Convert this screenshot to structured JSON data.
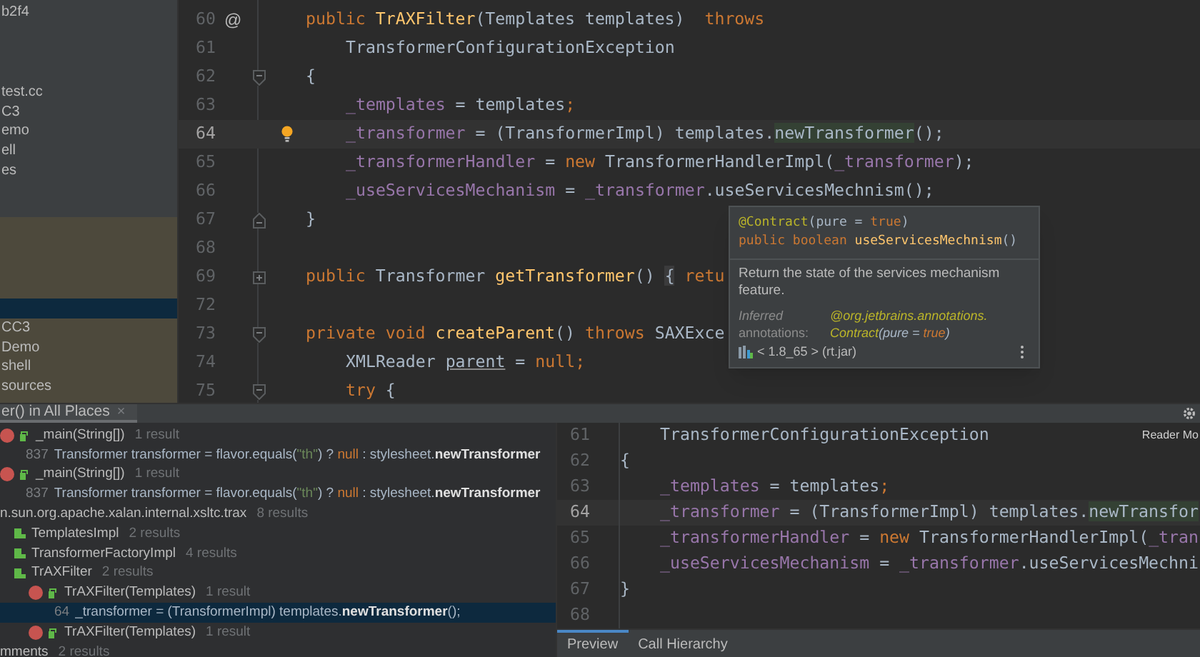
{
  "project_tree": {
    "sections": [
      {
        "highlighted": false,
        "items": [
          {
            "label": "b2f4",
            "selected": false
          },
          {
            "label": "test.cc",
            "selected": false
          },
          {
            "label": "C3",
            "selected": false
          },
          {
            "label": "emo",
            "selected": false
          },
          {
            "label": "ell",
            "selected": false
          },
          {
            "label": "es",
            "selected": false
          }
        ]
      },
      {
        "highlighted": true,
        "items": [
          {
            "selected": true
          },
          {
            "label": "CC3",
            "selected": false
          },
          {
            "label": "Demo",
            "selected": false
          },
          {
            "label": "shell",
            "selected": false
          },
          {
            "label": "sources",
            "selected": false
          }
        ]
      }
    ]
  },
  "editor": {
    "lines": [
      {
        "number": "60",
        "marker": "@",
        "bulb": false,
        "current": false,
        "indented": false,
        "segments": [
          {
            "kind": "kw",
            "text": "public "
          },
          {
            "kind": "fn",
            "text": "TrAXFilter"
          },
          {
            "kind": "plain",
            "text": "(Templates templates)  "
          },
          {
            "kind": "kw",
            "text": "throws"
          }
        ]
      },
      {
        "number": "61",
        "bulb": false,
        "current": false,
        "indented": true,
        "segments": [
          {
            "kind": "plain",
            "text": "TransformerConfigurationException"
          }
        ]
      },
      {
        "number": "62",
        "fold": {
          "kind": "open"
        },
        "bulb": false,
        "current": false,
        "indented": false,
        "segments": [
          {
            "kind": "plain",
            "text": "{"
          }
        ]
      },
      {
        "number": "63",
        "bulb": false,
        "current": false,
        "indented": true,
        "segments": [
          {
            "kind": "field",
            "text": "_templates"
          },
          {
            "kind": "plain",
            "text": " = templates"
          },
          {
            "kind": "kw",
            "text": ";"
          }
        ]
      },
      {
        "number": "64",
        "bulb": true,
        "current": true,
        "indented": true,
        "segments": [
          {
            "kind": "field",
            "text": "_transformer"
          },
          {
            "kind": "plain",
            "text": " = (TransformerImpl) templates."
          },
          {
            "kind": "match",
            "text": "newTransformer"
          },
          {
            "kind": "plain",
            "text": "();"
          }
        ]
      },
      {
        "number": "65",
        "bulb": false,
        "current": false,
        "indented": true,
        "segments": [
          {
            "kind": "field",
            "text": "_transformerHandler"
          },
          {
            "kind": "plain",
            "text": " = "
          },
          {
            "kind": "kw",
            "text": "new"
          },
          {
            "kind": "plain",
            "text": " TransformerHandlerImpl("
          },
          {
            "kind": "field",
            "text": "_transformer"
          },
          {
            "kind": "plain",
            "text": ");"
          }
        ]
      },
      {
        "number": "66",
        "bulb": false,
        "current": false,
        "indented": true,
        "segments": [
          {
            "kind": "field",
            "text": "_useServicesMechanism"
          },
          {
            "kind": "plain",
            "text": " = "
          },
          {
            "kind": "field",
            "text": "_transformer"
          },
          {
            "kind": "plain",
            "text": ".useServicesMechnism();"
          }
        ]
      },
      {
        "number": "67",
        "fold": {
          "kind": "close"
        },
        "bulb": false,
        "current": false,
        "indented": false,
        "segments": [
          {
            "kind": "plain",
            "text": "}"
          }
        ]
      },
      {
        "number": "68",
        "bulb": false,
        "current": false
      },
      {
        "number": "69",
        "fold": {
          "kind": "collapsed"
        },
        "bulb": false,
        "current": false,
        "indented": false,
        "segments": [
          {
            "kind": "kw",
            "text": "public "
          },
          {
            "kind": "plain",
            "text": "Transformer "
          },
          {
            "kind": "fn",
            "text": "getTransformer"
          },
          {
            "kind": "plain",
            "text": "() "
          },
          {
            "kind": "folded",
            "text": "{"
          },
          {
            "kind": "kw",
            "text": " retu"
          }
        ]
      },
      {
        "number": "72",
        "bulb": false,
        "current": false
      },
      {
        "number": "73",
        "fold": {
          "kind": "open"
        },
        "bulb": false,
        "current": false,
        "indented": false,
        "segments": [
          {
            "kind": "kw",
            "text": "private void "
          },
          {
            "kind": "fn",
            "text": "createParent"
          },
          {
            "kind": "plain",
            "text": "() "
          },
          {
            "kind": "kw",
            "text": "throws "
          },
          {
            "kind": "plain",
            "text": "SAXExce"
          }
        ]
      },
      {
        "number": "74",
        "bulb": false,
        "current": false,
        "indented": true,
        "segments": [
          {
            "kind": "plain",
            "text": "XMLReader "
          },
          {
            "kind": "under",
            "text": "parent"
          },
          {
            "kind": "plain",
            "text": " = "
          },
          {
            "kind": "kw",
            "text": "null;"
          }
        ]
      },
      {
        "number": "75",
        "fold": {
          "kind": "open"
        },
        "bulb": false,
        "current": false,
        "indented": true,
        "segments": [
          {
            "kind": "kw",
            "text": "try"
          },
          {
            "kind": "plain",
            "text": " {"
          }
        ]
      }
    ]
  },
  "tooltip": {
    "signature": [
      [
        {
          "kind": "anno",
          "text": "@Contract"
        },
        {
          "kind": "plain",
          "text": "(pure = "
        },
        {
          "kind": "kw",
          "text": "true"
        },
        {
          "kind": "plain",
          "text": ")"
        }
      ],
      [
        {
          "kind": "kw",
          "text": "public boolean "
        },
        {
          "kind": "fn",
          "text": "useServicesMechnism"
        },
        {
          "kind": "plain",
          "text": "()"
        }
      ]
    ],
    "description": "Return the state of the services mechanism feature.",
    "annotations_label": "*Inferred* annotations:",
    "annotations_value": [
      [
        {
          "kind": "anno",
          "text": "@org.jetbrains.annotations."
        }
      ],
      [
        {
          "kind": "anno",
          "text": "Contract"
        },
        {
          "kind": "plain",
          "text": "(pure = "
        },
        {
          "kind": "kw",
          "text": "true"
        },
        {
          "kind": "plain",
          "text": ")"
        }
      ]
    ],
    "library": "< 1.8_65 > (rt.jar)"
  },
  "find_panel": {
    "tab": {
      "label": "er() in All Places",
      "close": "×",
      "selected": true
    },
    "results": [
      {
        "kind": "method",
        "label": "_main(String[])",
        "count": "1 result",
        "selected": false,
        "children": [
          {
            "kind": "usage",
            "line": "837",
            "selected": false,
            "segments": [
              {
                "kind": "plain",
                "text": "Transformer transformer = flavor.equals("
              },
              {
                "kind": "str",
                "text": "\"th\""
              },
              {
                "kind": "plain",
                "text": ") ? "
              },
              {
                "kind": "kw",
                "text": "null"
              },
              {
                "kind": "plain",
                "text": " : stylesheet."
              },
              {
                "kind": "bold",
                "text": "newTransformer"
              }
            ]
          }
        ]
      },
      {
        "kind": "method",
        "label": "_main(String[])",
        "count": "1 result",
        "selected": false,
        "children": [
          {
            "kind": "usage",
            "line": "837",
            "selected": false,
            "segments": [
              {
                "kind": "plain",
                "text": "Transformer transformer = flavor.equals("
              },
              {
                "kind": "str",
                "text": "\"th\""
              },
              {
                "kind": "plain",
                "text": ") ? "
              },
              {
                "kind": "kw",
                "text": "null"
              },
              {
                "kind": "plain",
                "text": " : stylesheet."
              },
              {
                "kind": "bold",
                "text": "newTransformer"
              }
            ]
          }
        ]
      },
      {
        "kind": "package",
        "label": "n.sun.org.apache.xalan.internal.xsltc.trax",
        "count": "8 results",
        "selected": false,
        "children": [
          {
            "kind": "class",
            "label": "TemplatesImpl",
            "count": "2 results",
            "selected": false
          },
          {
            "kind": "class",
            "label": "TransformerFactoryImpl",
            "count": "4 results",
            "selected": false
          },
          {
            "kind": "class",
            "label": "TrAXFilter",
            "count": "2 results",
            "selected": false,
            "children": [
              {
                "kind": "method",
                "label": "TrAXFilter(Templates)",
                "count": "1 result",
                "selected": false,
                "children": [
                  {
                    "kind": "usage",
                    "line": "64",
                    "selected": true,
                    "segments": [
                      {
                        "kind": "plain",
                        "text": "_transformer = (TransformerImpl) templates."
                      },
                      {
                        "kind": "bold",
                        "text": "newTransformer"
                      },
                      {
                        "kind": "plain",
                        "text": "();"
                      }
                    ]
                  }
                ]
              },
              {
                "kind": "method",
                "label": "TrAXFilter(Templates)",
                "count": "1 result",
                "selected": false
              }
            ]
          }
        ]
      },
      {
        "kind": "package",
        "label": "mments",
        "count": "2 results",
        "selected": false
      }
    ],
    "preview": {
      "reader_mode": "Reader Mo",
      "lines": [
        {
          "number": "61",
          "current": false,
          "indented": true,
          "segments": [
            {
              "kind": "plain",
              "text": "TransformerConfigurationException"
            }
          ]
        },
        {
          "number": "62",
          "current": false,
          "indented": false,
          "segments": [
            {
              "kind": "plain",
              "text": "{"
            }
          ]
        },
        {
          "number": "63",
          "current": false,
          "indented": true,
          "segments": [
            {
              "kind": "field",
              "text": "_templates"
            },
            {
              "kind": "plain",
              "text": " = templates"
            },
            {
              "kind": "kw",
              "text": ";"
            }
          ]
        },
        {
          "number": "64",
          "current": true,
          "indented": true,
          "segments": [
            {
              "kind": "field",
              "text": "_transformer"
            },
            {
              "kind": "plain",
              "text": " = (TransformerImpl) templates."
            },
            {
              "kind": "match",
              "text": "newTransfor"
            }
          ]
        },
        {
          "number": "65",
          "current": false,
          "indented": true,
          "segments": [
            {
              "kind": "field",
              "text": "_transformerHandler"
            },
            {
              "kind": "plain",
              "text": " = "
            },
            {
              "kind": "kw",
              "text": "new"
            },
            {
              "kind": "plain",
              "text": " TransformerHandlerImpl("
            },
            {
              "kind": "field",
              "text": "_tran"
            }
          ]
        },
        {
          "number": "66",
          "current": false,
          "indented": true,
          "segments": [
            {
              "kind": "field",
              "text": "_useServicesMechanism"
            },
            {
              "kind": "plain",
              "text": " = "
            },
            {
              "kind": "field",
              "text": "_transformer"
            },
            {
              "kind": "plain",
              "text": ".useServicesMechni"
            }
          ]
        },
        {
          "number": "67",
          "current": false,
          "indented": false,
          "segments": [
            {
              "kind": "plain",
              "text": "}"
            }
          ]
        },
        {
          "number": "68",
          "current": false
        }
      ]
    },
    "bottom_tabs": [
      {
        "label": "Preview",
        "selected": true
      },
      {
        "label": "Call Hierarchy",
        "selected": false
      }
    ]
  }
}
